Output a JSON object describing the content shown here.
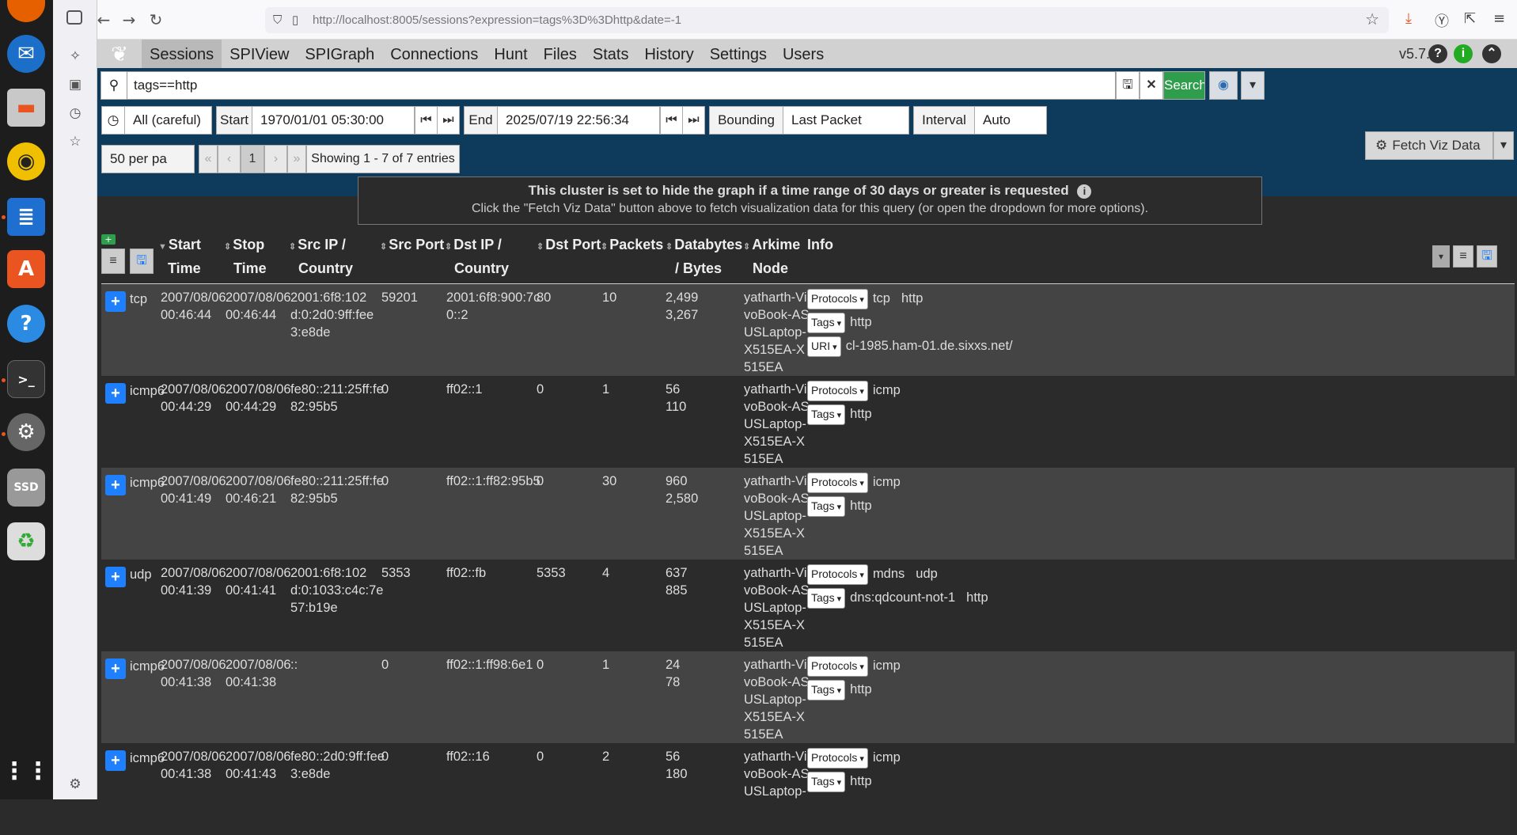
{
  "browser": {
    "url": "http://localhost:8005/sessions?expression=tags%3D%3Dhttp&date=-1"
  },
  "nav": {
    "items": [
      "Sessions",
      "SPIView",
      "SPIGraph",
      "Connections",
      "Hunt",
      "Files",
      "Stats",
      "History",
      "Settings",
      "Users"
    ],
    "version": "v5.7.0"
  },
  "search": {
    "expression": "tags==http",
    "search_label": "Search"
  },
  "time": {
    "range": "All (careful)",
    "start_label": "Start",
    "start_value": "1970/01/01 05:30:00",
    "end_label": "End",
    "end_value": "2025/07/19 22:56:34",
    "bounding_label": "Bounding",
    "bounding_value": "Last Packet",
    "interval_label": "Interval",
    "interval_value": "Auto"
  },
  "paging": {
    "per_page": "50 per pa",
    "first": "«",
    "prev": "‹",
    "page": "1",
    "next": "›",
    "last": "»",
    "showing": "Showing 1 - 7 of 7 entries",
    "fetch_viz": "Fetch Viz Data"
  },
  "warning": {
    "title": "This cluster is set to hide the graph if a time range of 30 days or greater is requested",
    "subtitle": "Click the \"Fetch Viz Data\" button above to fetch visualization data for this query (or open the dropdown for more options)."
  },
  "columns": {
    "start": [
      "Start",
      "Time"
    ],
    "stop": [
      "Stop",
      "Time"
    ],
    "src_ip": [
      "Src IP /",
      "Country"
    ],
    "src_port": "Src Port",
    "dst_ip": [
      "Dst IP /",
      "Country"
    ],
    "dst_port": "Dst Port",
    "packets": "Packets",
    "bytes": [
      "Databytes",
      "/ Bytes"
    ],
    "node": [
      "Arkime",
      "Node"
    ],
    "info": "Info"
  },
  "rows": [
    {
      "proto": "tcp",
      "start": [
        "2007/08/06",
        "00:46:44"
      ],
      "stop": [
        "2007/08/06",
        "00:46:44"
      ],
      "src": [
        "2001:6f8:102",
        "d:0:2d0:9ff:fee",
        "3:e8de"
      ],
      "sport": "59201",
      "dst": [
        "2001:6f8:900:7c",
        "0::2"
      ],
      "dport": "80",
      "packets": "10",
      "bytes": [
        "2,499",
        "3,267"
      ],
      "node": [
        "yatharth-Vi",
        "voBook-AS",
        "USLaptop-",
        "X515EA-X",
        "515EA"
      ],
      "info": [
        {
          "label": "Protocols",
          "vals": [
            "tcp",
            "http"
          ]
        },
        {
          "label": "Tags",
          "vals": [
            "http"
          ]
        },
        {
          "label": "URI",
          "vals": [
            "cl-1985.ham-01.de.sixxs.net/"
          ]
        }
      ]
    },
    {
      "proto": "icmp6",
      "start": [
        "2007/08/06",
        "00:44:29"
      ],
      "stop": [
        "2007/08/06",
        "00:44:29"
      ],
      "src": [
        "fe80::211:25ff:fe",
        "82:95b5"
      ],
      "sport": "0",
      "dst": [
        "ff02::1"
      ],
      "dport": "0",
      "packets": "1",
      "bytes": [
        "56",
        "110"
      ],
      "node": [
        "yatharth-Vi",
        "voBook-AS",
        "USLaptop-",
        "X515EA-X",
        "515EA"
      ],
      "info": [
        {
          "label": "Protocols",
          "vals": [
            "icmp"
          ]
        },
        {
          "label": "Tags",
          "vals": [
            "http"
          ]
        }
      ]
    },
    {
      "proto": "icmp6",
      "start": [
        "2007/08/06",
        "00:41:49"
      ],
      "stop": [
        "2007/08/06",
        "00:46:21"
      ],
      "src": [
        "fe80::211:25ff:fe",
        "82:95b5"
      ],
      "sport": "0",
      "dst": [
        "ff02::1:ff82:95b5"
      ],
      "dport": "0",
      "packets": "30",
      "bytes": [
        "960",
        "2,580"
      ],
      "node": [
        "yatharth-Vi",
        "voBook-AS",
        "USLaptop-",
        "X515EA-X",
        "515EA"
      ],
      "info": [
        {
          "label": "Protocols",
          "vals": [
            "icmp"
          ]
        },
        {
          "label": "Tags",
          "vals": [
            "http"
          ]
        }
      ]
    },
    {
      "proto": "udp",
      "start": [
        "2007/08/06",
        "00:41:39"
      ],
      "stop": [
        "2007/08/06",
        "00:41:41"
      ],
      "src": [
        "2001:6f8:102",
        "d:0:1033:c4c:7e",
        "57:b19e"
      ],
      "sport": "5353",
      "dst": [
        "ff02::fb"
      ],
      "dport": "5353",
      "packets": "4",
      "bytes": [
        "637",
        "885"
      ],
      "node": [
        "yatharth-Vi",
        "voBook-AS",
        "USLaptop-",
        "X515EA-X",
        "515EA"
      ],
      "info": [
        {
          "label": "Protocols",
          "vals": [
            "mdns",
            "udp"
          ]
        },
        {
          "label": "Tags",
          "vals": [
            "dns:qdcount-not-1",
            "http"
          ]
        }
      ]
    },
    {
      "proto": "icmp6",
      "start": [
        "2007/08/06",
        "00:41:38"
      ],
      "stop": [
        "2007/08/06",
        "00:41:38"
      ],
      "src": [
        "::"
      ],
      "sport": "0",
      "dst": [
        "ff02::1:ff98:6e1"
      ],
      "dport": "0",
      "packets": "1",
      "bytes": [
        "24",
        "78"
      ],
      "node": [
        "yatharth-Vi",
        "voBook-AS",
        "USLaptop-",
        "X515EA-X",
        "515EA"
      ],
      "info": [
        {
          "label": "Protocols",
          "vals": [
            "icmp"
          ]
        },
        {
          "label": "Tags",
          "vals": [
            "http"
          ]
        }
      ]
    },
    {
      "proto": "icmp6",
      "start": [
        "2007/08/06",
        "00:41:38"
      ],
      "stop": [
        "2007/08/06",
        "00:41:43"
      ],
      "src": [
        "fe80::2d0:9ff:fee",
        "3:e8de"
      ],
      "sport": "0",
      "dst": [
        "ff02::16"
      ],
      "dport": "0",
      "packets": "2",
      "bytes": [
        "56",
        "180"
      ],
      "node": [
        "yatharth-Vi",
        "voBook-AS",
        "USLaptop-"
      ],
      "info": [
        {
          "label": "Protocols",
          "vals": [
            "icmp"
          ]
        },
        {
          "label": "Tags",
          "vals": [
            "http"
          ]
        }
      ]
    }
  ]
}
